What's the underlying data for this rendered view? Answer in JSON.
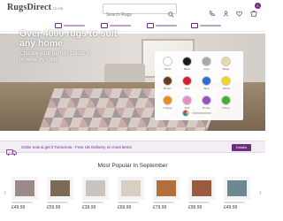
{
  "header": {
    "logo_main": "RugsDirect",
    "logo_suffix": ".co.uk",
    "search_placeholder": "Search Rugs",
    "basket_count": "0"
  },
  "hero": {
    "title": "Over 4000 rugs to suit any home",
    "subtitle": "Choose your perfect colour or browse by room"
  },
  "colour_picker": {
    "swatches": [
      {
        "name": "White",
        "hex": "#ffffff"
      },
      {
        "name": "Black",
        "hex": "#1b1b1b"
      },
      {
        "name": "Grey",
        "hex": "#a8a8a8"
      },
      {
        "name": "Beige",
        "hex": "#e8d9a8"
      },
      {
        "name": "Brown",
        "hex": "#6a3b1e"
      },
      {
        "name": "Red",
        "hex": "#d3202a"
      },
      {
        "name": "Blue",
        "hex": "#2b6fd1"
      },
      {
        "name": "Yellow",
        "hex": "#f2d81a"
      },
      {
        "name": "Orange",
        "hex": "#f08a16"
      },
      {
        "name": "Pink",
        "hex": "#e48ec8"
      },
      {
        "name": "Purple",
        "hex": "#9b4fc4"
      },
      {
        "name": "Green",
        "hex": "#3fae3a"
      }
    ]
  },
  "promo": {
    "text": "Order now & get it Tomorrow - Free UK Delivery on most items",
    "button": "Details"
  },
  "products": {
    "title": "Most Popular In September",
    "items": [
      {
        "price": "£49.99",
        "color": "#9b8a8a"
      },
      {
        "price": "£59.99",
        "color": "#7c6a59"
      },
      {
        "price": "£39.99",
        "color": "#c9c4bf"
      },
      {
        "price": "£69.99",
        "color": "#d8cfc2"
      },
      {
        "price": "£79.99",
        "color": "#b26f3a"
      },
      {
        "price": "£99.99",
        "color": "#9a5a3e"
      },
      {
        "price": "£49.99",
        "color": "#6d8891"
      }
    ]
  },
  "colors": {
    "accent": "#6b2d7e"
  }
}
